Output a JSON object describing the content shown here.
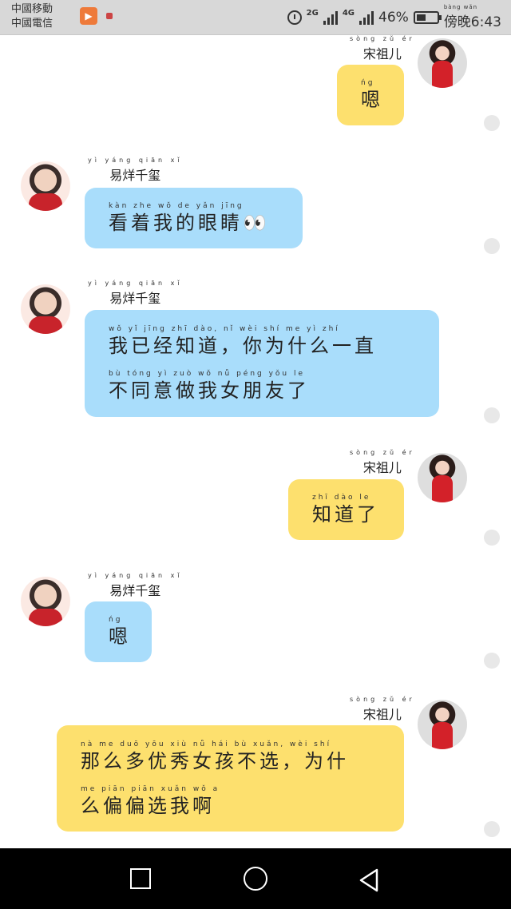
{
  "status_bar": {
    "carrier1": "中國移動",
    "carrier2": "中國電信",
    "net1": "2G",
    "net2": "4G",
    "battery": "46%",
    "battery_level": 0.46,
    "time_pinyin": "bàng wǎn",
    "time": "傍晚6:43"
  },
  "users": {
    "girl": {
      "name": "宋祖儿",
      "name_pinyin": "sòng zǔ ér"
    },
    "boy": {
      "name": "易烊千玺",
      "name_pinyin": "yì yáng qiān xǐ"
    }
  },
  "messages": [
    {
      "sender": "girl",
      "lines": [
        {
          "py": "ńg",
          "zh": "嗯"
        }
      ]
    },
    {
      "sender": "boy",
      "lines": [
        {
          "py": "kàn zhe wǒ de yǎn jīng",
          "zh": "看着我的眼睛👀"
        }
      ]
    },
    {
      "sender": "boy",
      "lines": [
        {
          "py": "wǒ yǐ jīng zhī dào, nǐ wèi shí me yì zhí",
          "zh": "我已经知道，你为什么一直"
        },
        {
          "py": "bù tóng yì zuò wǒ nǚ péng yǒu le",
          "zh": "不同意做我女朋友了"
        }
      ]
    },
    {
      "sender": "girl",
      "lines": [
        {
          "py": "zhī dào le",
          "zh": "知道了"
        }
      ]
    },
    {
      "sender": "boy",
      "lines": [
        {
          "py": "ńg",
          "zh": "嗯"
        }
      ]
    },
    {
      "sender": "girl",
      "lines": [
        {
          "py": "nà me duō yōu xiù nǚ hái bù xuǎn, wèi shí",
          "zh": "那么多优秀女孩不选，为什"
        },
        {
          "py": "me piān piān xuǎn wǒ a",
          "zh": "么偏偏选我啊"
        }
      ]
    }
  ],
  "colors": {
    "blue_bubble": "#a9ddfb",
    "yellow_bubble": "#fde06e",
    "status_bar": "#d8d8d8",
    "nav_bar": "#000000"
  },
  "nav": {
    "recent_icon": "square-icon",
    "home_icon": "circle-icon",
    "back_icon": "triangle-back-icon"
  }
}
